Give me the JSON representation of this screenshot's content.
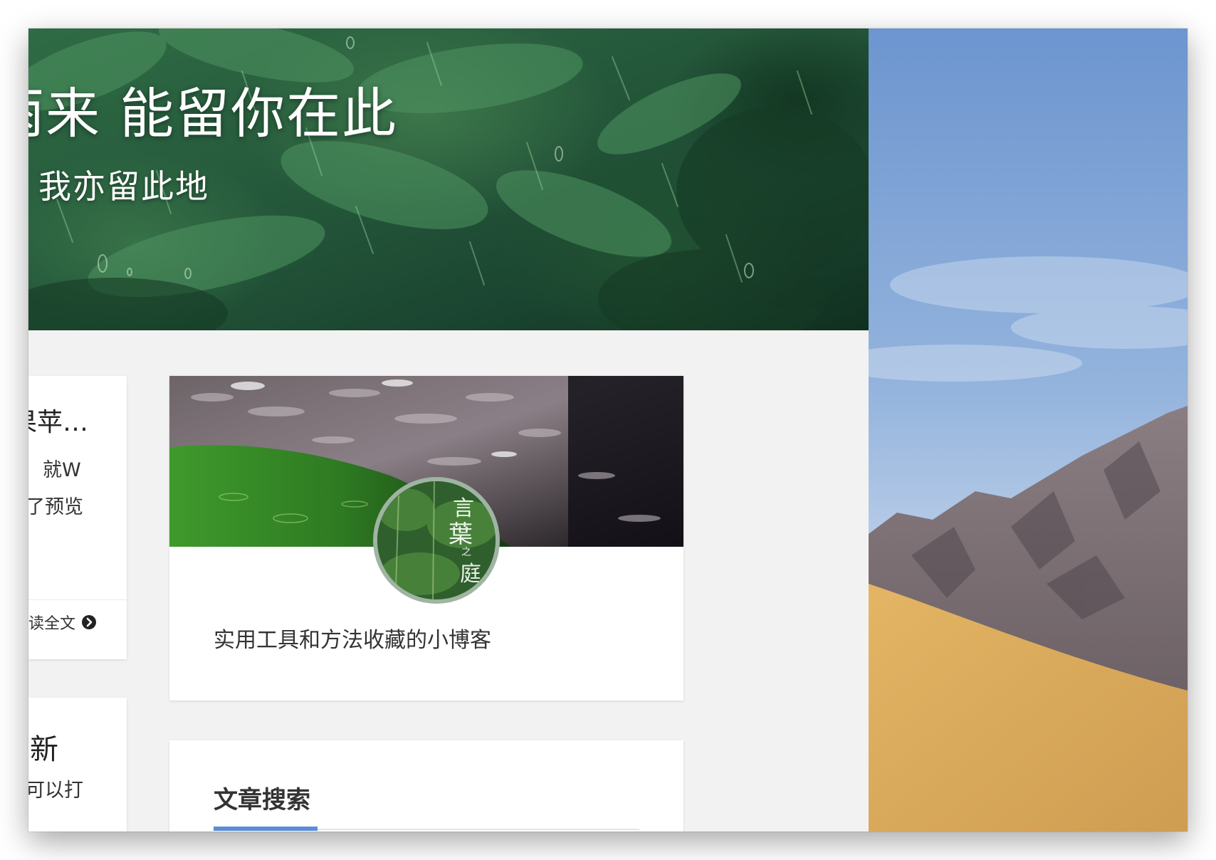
{
  "hero": {
    "title": "雨来 能留你在此",
    "subtitle": "我亦留此地"
  },
  "posts": [
    {
      "title": "果苹…",
      "lines": [
        "就W",
        "了预览"
      ],
      "read_more": "读全文",
      "read_more_icon": "chevron-circle-right-icon"
    },
    {
      "title": "新",
      "lines": [
        "可以打"
      ]
    }
  ],
  "profile": {
    "avatar_text": "言葉之庭",
    "description": "实用工具和方法收藏的小博客"
  },
  "search_widget": {
    "title": "文章搜索",
    "accent_color": "#5b8dd6"
  },
  "colors": {
    "page_background": "#f2f2f2",
    "hero_green": "#24573a",
    "desktop_sky": "#8fb1dc",
    "desktop_sand": "#d8a95c"
  }
}
